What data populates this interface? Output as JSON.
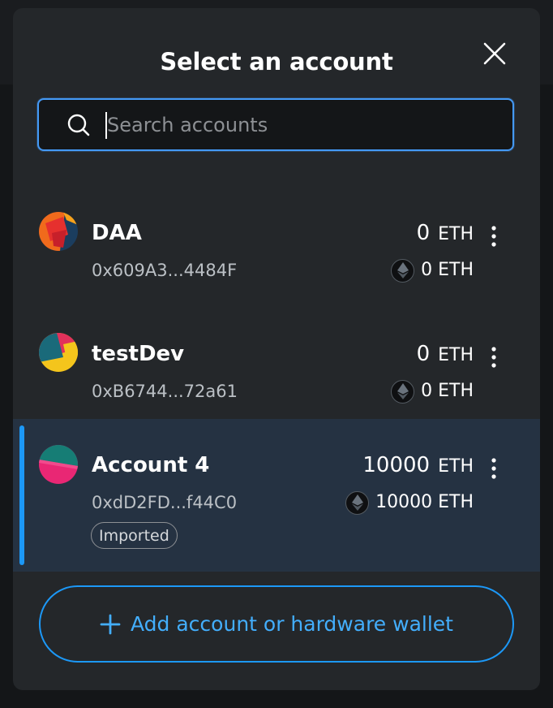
{
  "modal": {
    "title": "Select an account",
    "close_icon": "close-icon"
  },
  "search": {
    "placeholder": "Search accounts",
    "value": "",
    "icon": "search-icon"
  },
  "accounts": [
    {
      "name": "DAA",
      "address": "0x609A3...4484F",
      "balance_value": "0",
      "balance_unit": "ETH",
      "secondary_balance": "0 ETH",
      "badge": "",
      "selected": false
    },
    {
      "name": "testDev",
      "address": "0xB6744...72a61",
      "balance_value": "0",
      "balance_unit": "ETH",
      "secondary_balance": "0 ETH",
      "badge": "",
      "selected": false
    },
    {
      "name": "Account 4",
      "address": "0xdD2FD...f44C0",
      "balance_value": "10000",
      "balance_unit": "ETH",
      "secondary_balance": "10000 ETH",
      "badge": "Imported",
      "selected": true
    }
  ],
  "add_button": {
    "label": "Add account or hardware wallet",
    "icon": "plus-icon"
  },
  "colors": {
    "accent": "#1c98f7",
    "modal_bg": "#24272a",
    "selected_bg": "#253242",
    "muted_text": "#bbc0c5"
  }
}
